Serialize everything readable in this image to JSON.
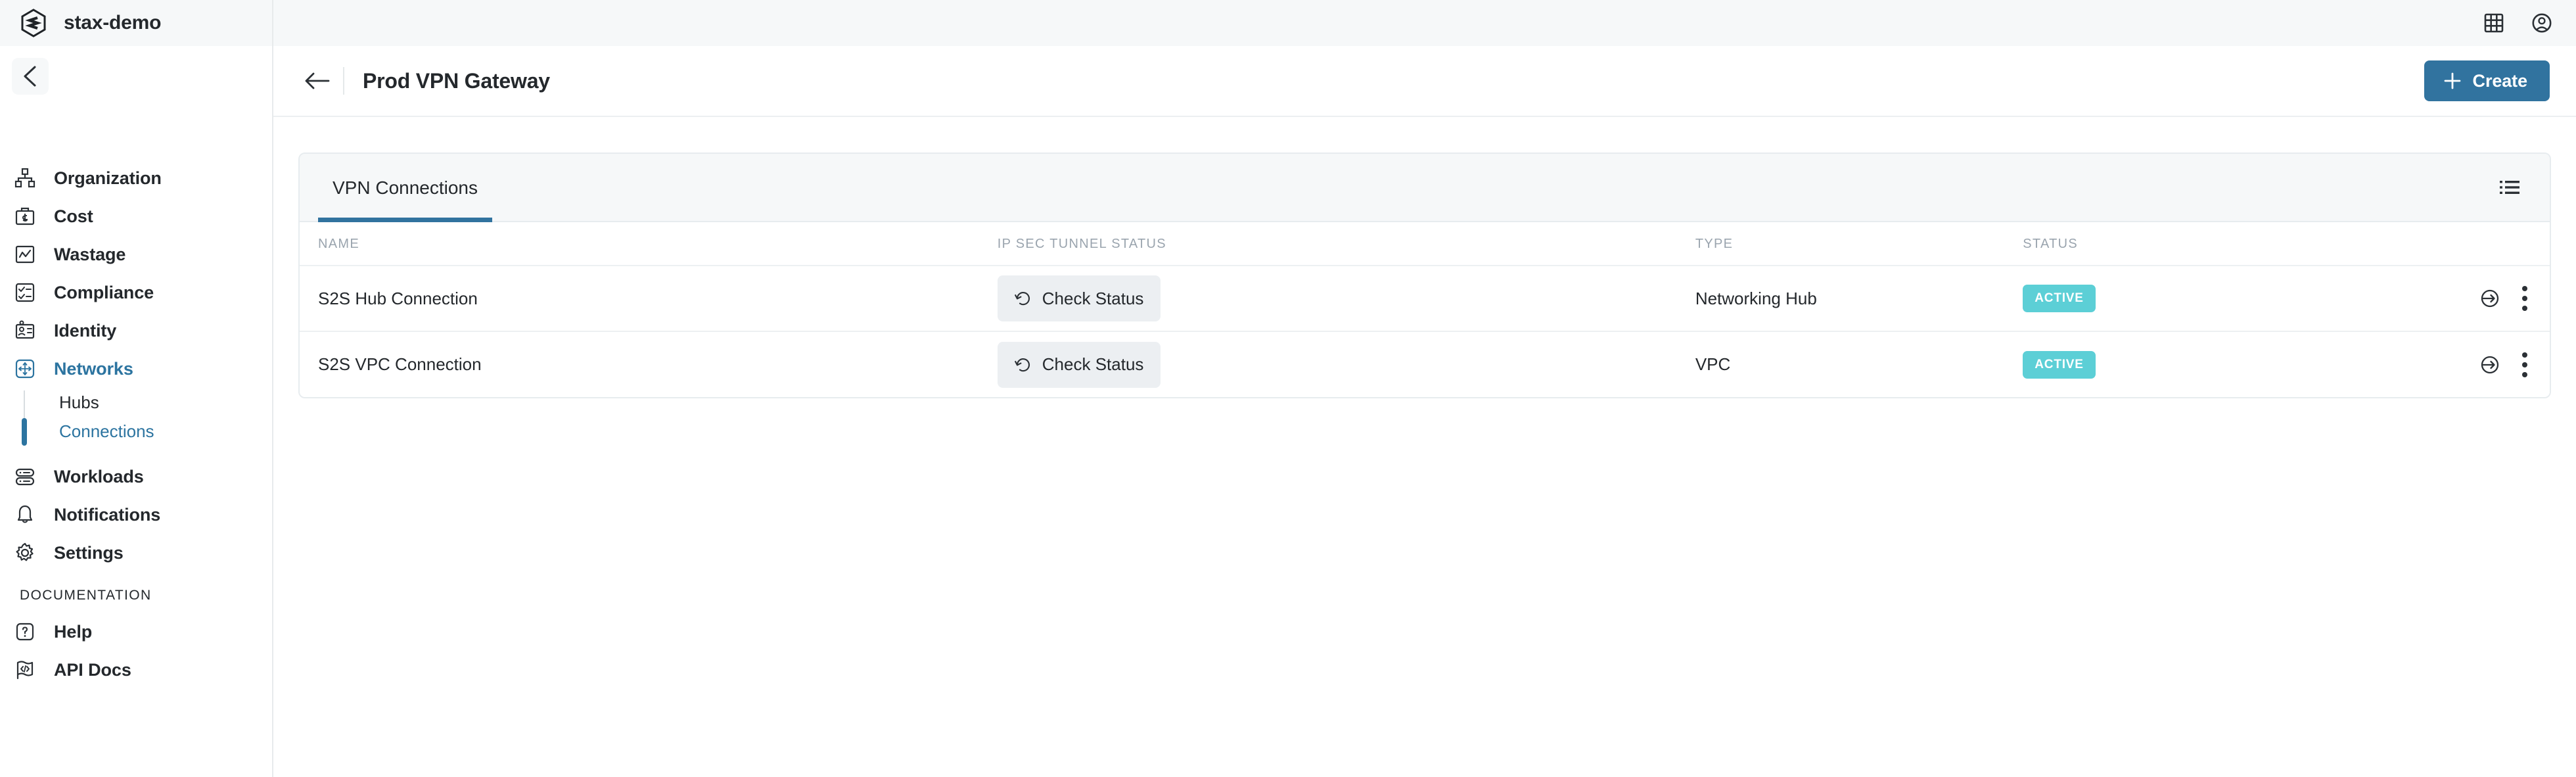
{
  "brand": {
    "name": "stax-demo",
    "logo_icon": "stax-hexagon-logo"
  },
  "sidebar": {
    "collapse_icon": "chevron-left-icon",
    "items": [
      {
        "label": "Organization",
        "icon": "org-chart-icon",
        "active": false
      },
      {
        "label": "Cost",
        "icon": "briefcase-dollar-icon",
        "active": false
      },
      {
        "label": "Wastage",
        "icon": "chart-line-box-icon",
        "active": false
      },
      {
        "label": "Compliance",
        "icon": "checklist-icon",
        "active": false
      },
      {
        "label": "Identity",
        "icon": "id-card-icon",
        "active": false
      },
      {
        "label": "Networks",
        "icon": "move-arrows-box-icon",
        "active": true
      }
    ],
    "subitems": [
      {
        "label": "Hubs",
        "active": false
      },
      {
        "label": "Connections",
        "active": true
      }
    ],
    "items_after": [
      {
        "label": "Workloads",
        "icon": "server-stack-icon",
        "active": false
      },
      {
        "label": "Notifications",
        "icon": "bell-icon",
        "active": false
      },
      {
        "label": "Settings",
        "icon": "gear-icon",
        "active": false
      }
    ],
    "documentation_label": "DOCUMENTATION",
    "documentation_items": [
      {
        "label": "Help",
        "icon": "question-box-icon"
      },
      {
        "label": "API Docs",
        "icon": "code-flag-icon"
      }
    ]
  },
  "topbar": {
    "apps_icon": "grid-apps-icon",
    "account_icon": "user-circle-icon"
  },
  "pagehead": {
    "back_icon": "arrow-left-icon",
    "title": "Prod VPN Gateway",
    "create_label": "Create",
    "create_icon": "plus-icon",
    "create_color": "#31739f"
  },
  "card": {
    "tabs": [
      {
        "label": "VPN Connections",
        "active": true
      }
    ],
    "list_view_icon": "bullet-list-icon",
    "columns": [
      "NAME",
      "IP SEC TUNNEL STATUS",
      "TYPE",
      "STATUS"
    ],
    "rows": [
      {
        "name": "S2S Hub Connection",
        "tunnel_action_label": "Check Status",
        "tunnel_action_icon": "rotate-left-icon",
        "type": "Networking Hub",
        "status": "ACTIVE",
        "status_color": "#5ccfd6",
        "enter_icon": "arrow-into-circle-icon",
        "more_icon": "three-dots-vertical-icon"
      },
      {
        "name": "S2S VPC Connection",
        "tunnel_action_label": "Check Status",
        "tunnel_action_icon": "rotate-left-icon",
        "type": "VPC",
        "status": "ACTIVE",
        "status_color": "#5ccfd6",
        "enter_icon": "arrow-into-circle-icon",
        "more_icon": "three-dots-vertical-icon"
      }
    ]
  }
}
